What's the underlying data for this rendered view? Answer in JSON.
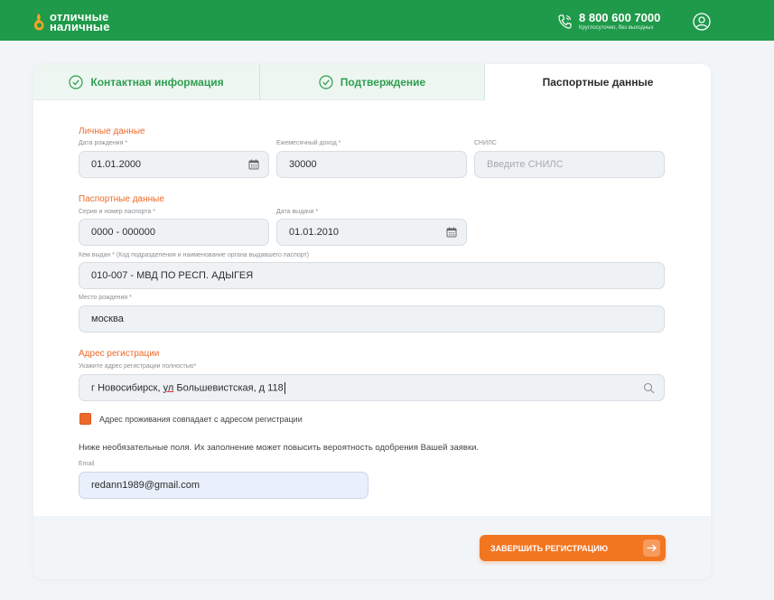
{
  "header": {
    "logo_line1": "отличные",
    "logo_line2": "наличные",
    "phone": "8 800 600 7000",
    "phone_sub": "Круглосуточно, без выходных",
    "brand_color": "#1f9a4a"
  },
  "tabs": [
    {
      "label": "Контактная информация",
      "state": "done",
      "icon": "check-circle-icon"
    },
    {
      "label": "Подтверждение",
      "state": "done",
      "icon": "check-circle-icon"
    },
    {
      "label": "Паспортные данные",
      "state": "active"
    }
  ],
  "personal": {
    "title": "Личные данные",
    "birth_label": "Дата рождения *",
    "birth_value": "01.01.2000",
    "income_label": "Ежемесячный доход *",
    "income_value": "30000",
    "snils_label": "СНИЛС",
    "snils_placeholder": "Введите СНИЛС"
  },
  "passport": {
    "title": "Паспортные данные",
    "series_label": "Серия и номер паспорта *",
    "series_value": "0000 - 000000",
    "issue_date_label": "Дата выдачи *",
    "issue_date_value": "01.01.2010",
    "issuer_label": "Кем выдан * (Код подразделения и наименование органа выдавшего паспорт)",
    "issuer_value": "010-007 - МВД ПО РЕСП. АДЫГЕЯ",
    "birthplace_label": "Место рождения *",
    "birthplace_value": "москва"
  },
  "registration": {
    "title": "Адрес регистрации",
    "address_label": "Укажите адрес регистрации полностью*",
    "address_prefix": "г Новосибирск, ",
    "address_underlined": "ул",
    "address_suffix": " Большевистская, д 118",
    "same_address_label": "Адрес проживания совпадает с адресом регистрации",
    "same_address_checked": true
  },
  "optional": {
    "note": "Ниже необязательные поля. Их заполнение может повысить вероятность одобрения Вашей заявки.",
    "email_label": "Email",
    "email_value": "redann1989@gmail.com"
  },
  "submit_label": "ЗАВЕРШИТЬ РЕГИСТРАЦИЮ",
  "accent_color": "#ee6a2a"
}
